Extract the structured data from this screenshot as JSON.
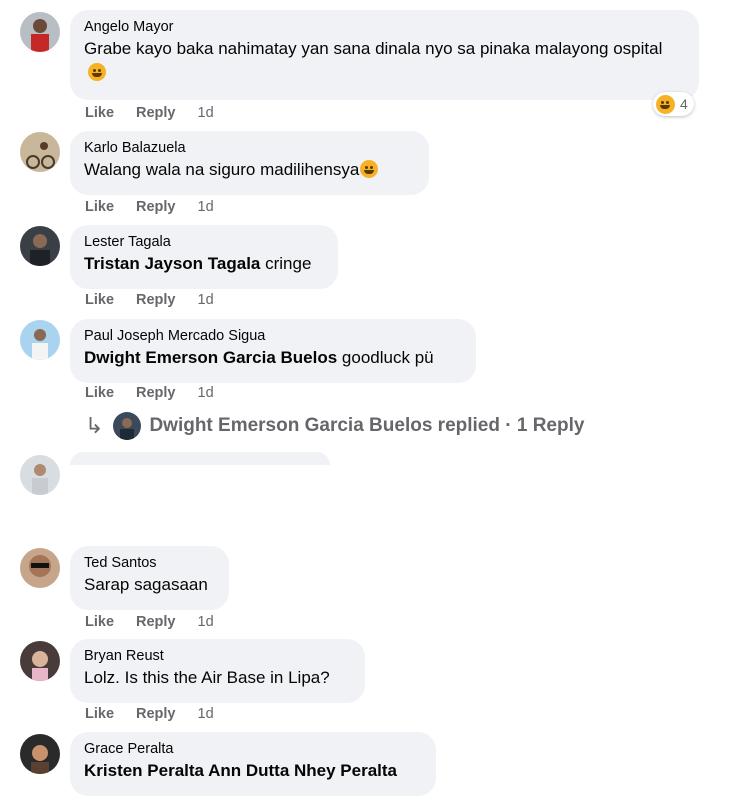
{
  "comments": [
    {
      "author": "Angelo Mayor",
      "text": "Grabe kayo baka nahimatay yan sana dinala nyo sa pinaka malayong ospital",
      "emoji": "rofl-emoji",
      "reaction": {
        "emoji": "laugh-emoji",
        "count": "4"
      },
      "like": "Like",
      "reply": "Reply",
      "time": "1d"
    },
    {
      "author": "Karlo Balazuela",
      "text": "Walang wala na siguro madilihensya",
      "emoji": "grin-sweat-emoji",
      "like": "Like",
      "reply": "Reply",
      "time": "1d"
    },
    {
      "author": "Lester Tagala",
      "mention": "Tristan Jayson Tagala",
      "text": "cringe",
      "like": "Like",
      "reply": "Reply",
      "time": "1d"
    },
    {
      "author": "Paul Joseph Mercado Sigua",
      "mention": "Dwight Emerson Garcia Buelos",
      "text": "goodluck pü",
      "like": "Like",
      "reply": "Reply",
      "time": "1d",
      "replies": "Dwight Emerson Garcia Buelos replied · 1 Reply"
    },
    {
      "author": "Ted Santos",
      "text": "Sarap sagasaan",
      "like": "Like",
      "reply": "Reply",
      "time": "1d"
    },
    {
      "author": "Bryan Reust",
      "text": "Lolz. Is this the Air Base in Lipa?",
      "like": "Like",
      "reply": "Reply",
      "time": "1d"
    },
    {
      "author": "Grace Peralta",
      "mention": "Kristen Peralta Ann Dutta Nhey Peralta"
    }
  ],
  "colors": {
    "bubble": "#f0f2f5",
    "secondary_text": "#65676b",
    "primary_text": "#050505"
  }
}
